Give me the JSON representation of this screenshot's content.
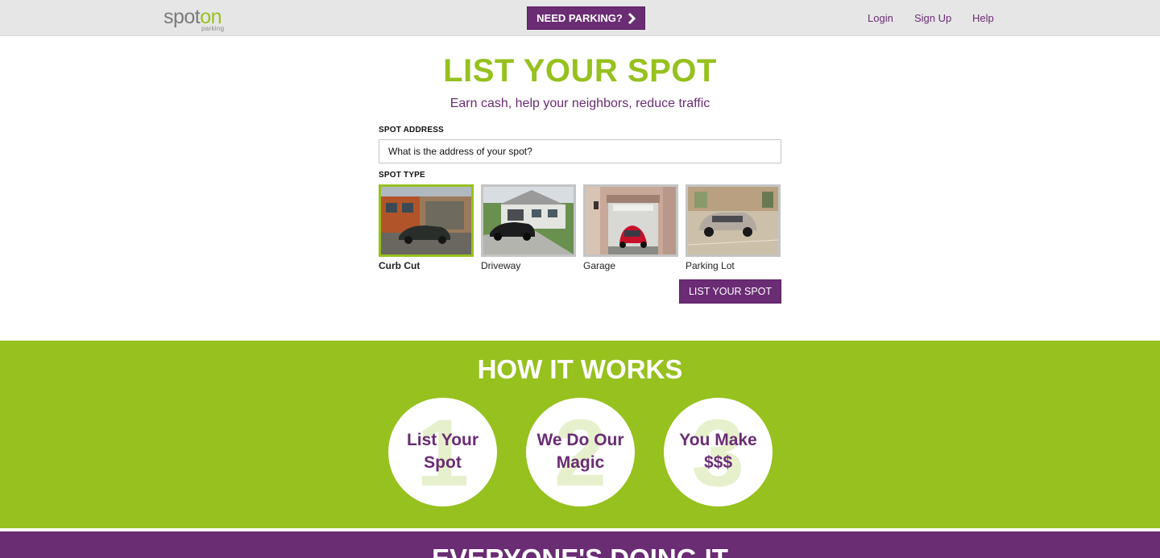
{
  "header": {
    "logo_word_1": "spot",
    "logo_word_2": "on",
    "logo_sub": "parking",
    "need_parking_label": "NEED PARKING?",
    "nav": {
      "login": "Login",
      "signup": "Sign Up",
      "help": "Help"
    }
  },
  "hero": {
    "title": "LIST YOUR SPOT",
    "subtitle": "Earn cash, help your neighbors, reduce traffic"
  },
  "form": {
    "address_label": "SPOT ADDRESS",
    "address_placeholder": "What is the address of your spot?",
    "address_value": "",
    "type_label": "SPOT TYPE",
    "types": [
      {
        "label": "Curb Cut",
        "selected": true
      },
      {
        "label": "Driveway",
        "selected": false
      },
      {
        "label": "Garage",
        "selected": false
      },
      {
        "label": "Parking Lot",
        "selected": false
      }
    ],
    "submit_label": "LIST YOUR SPOT"
  },
  "how_it_works": {
    "title": "HOW IT WORKS",
    "steps": [
      {
        "number": "1",
        "line1": "List Your",
        "line2": "Spot"
      },
      {
        "number": "2",
        "line1": "We Do Our",
        "line2": "Magic"
      },
      {
        "number": "3",
        "line1": "You Make",
        "line2": "$$$"
      }
    ]
  },
  "everyone": {
    "title": "EVERYONE'S DOING IT"
  },
  "colors": {
    "brand_purple": "#6a2c73",
    "brand_green": "#96c11f",
    "header_gray": "#e6e6e6"
  },
  "icons": {
    "need_parking_chevron": "chevron-right-icon"
  }
}
